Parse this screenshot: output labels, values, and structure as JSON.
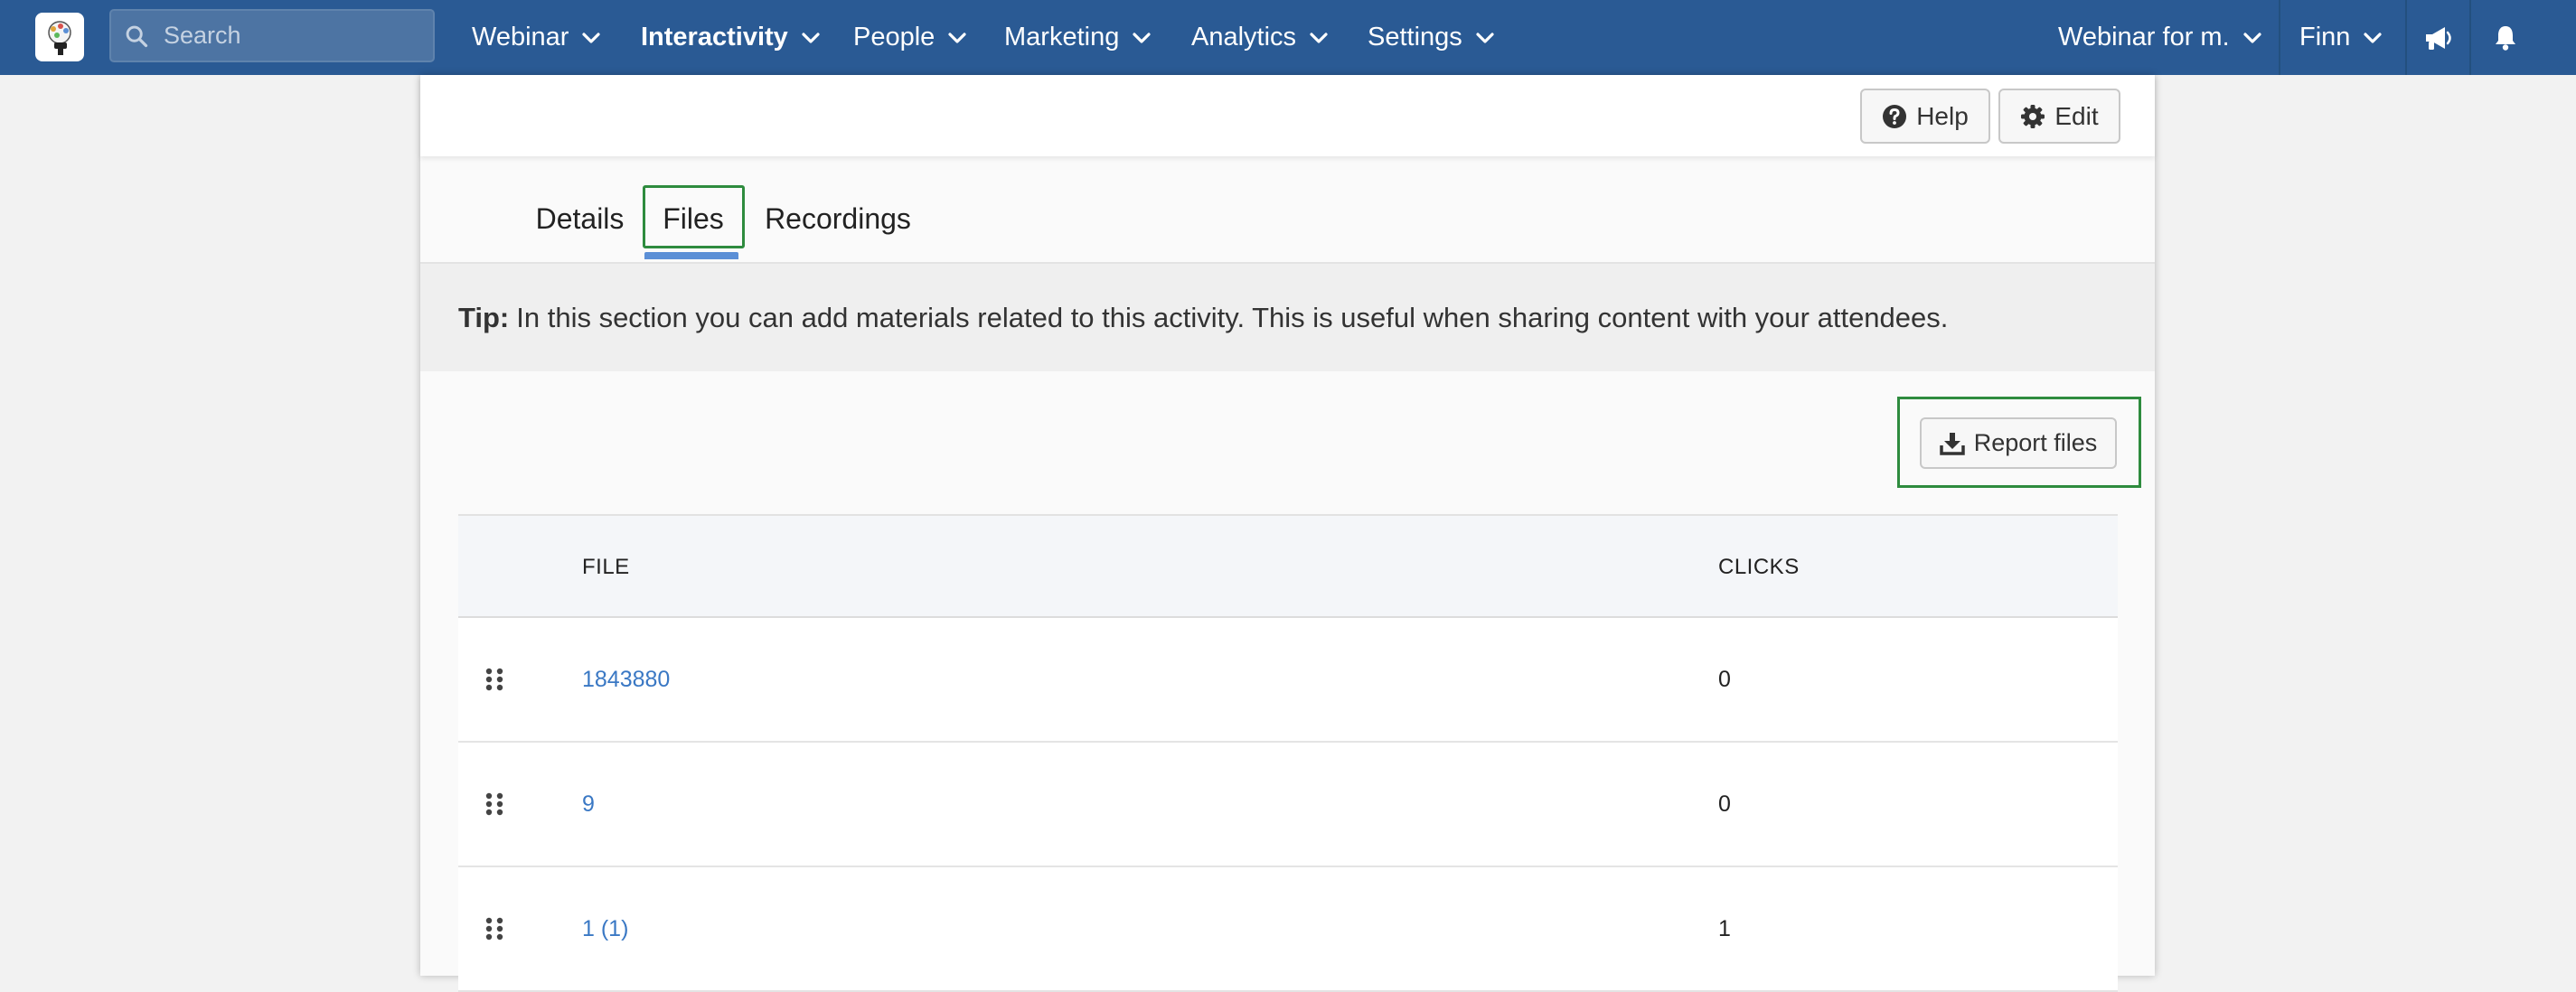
{
  "navbar": {
    "search_placeholder": "Search",
    "items": [
      {
        "label": "Webinar",
        "active": false
      },
      {
        "label": "Interactivity",
        "active": true
      },
      {
        "label": "People",
        "active": false
      },
      {
        "label": "Marketing",
        "active": false
      },
      {
        "label": "Analytics",
        "active": false
      },
      {
        "label": "Settings",
        "active": false
      }
    ],
    "webinar_selector": "Webinar for m.",
    "user_menu": "Finn",
    "icons": [
      "megaphone-icon",
      "bell-icon"
    ],
    "background_color": "#2a5a94"
  },
  "header": {
    "help_label": "Help",
    "edit_label": "Edit"
  },
  "tabs": [
    {
      "label": "Details",
      "active": false
    },
    {
      "label": "Files",
      "active": true
    },
    {
      "label": "Recordings",
      "active": false
    }
  ],
  "tip": {
    "prefix": "Tip:",
    "text": "In this section you can add materials related to this activity. This is useful when sharing content with your attendees."
  },
  "report_button_label": "Report files",
  "table": {
    "columns": [
      "FILE",
      "CLICKS"
    ],
    "rows": [
      {
        "file": "1843880",
        "clicks": "0"
      },
      {
        "file": "9",
        "clicks": "0"
      },
      {
        "file": "1 (1)",
        "clicks": "1"
      }
    ]
  },
  "colors": {
    "accent_link": "#3a78c4",
    "tab_underline": "#5b8fd6",
    "highlight_border": "#2e8b3e"
  }
}
